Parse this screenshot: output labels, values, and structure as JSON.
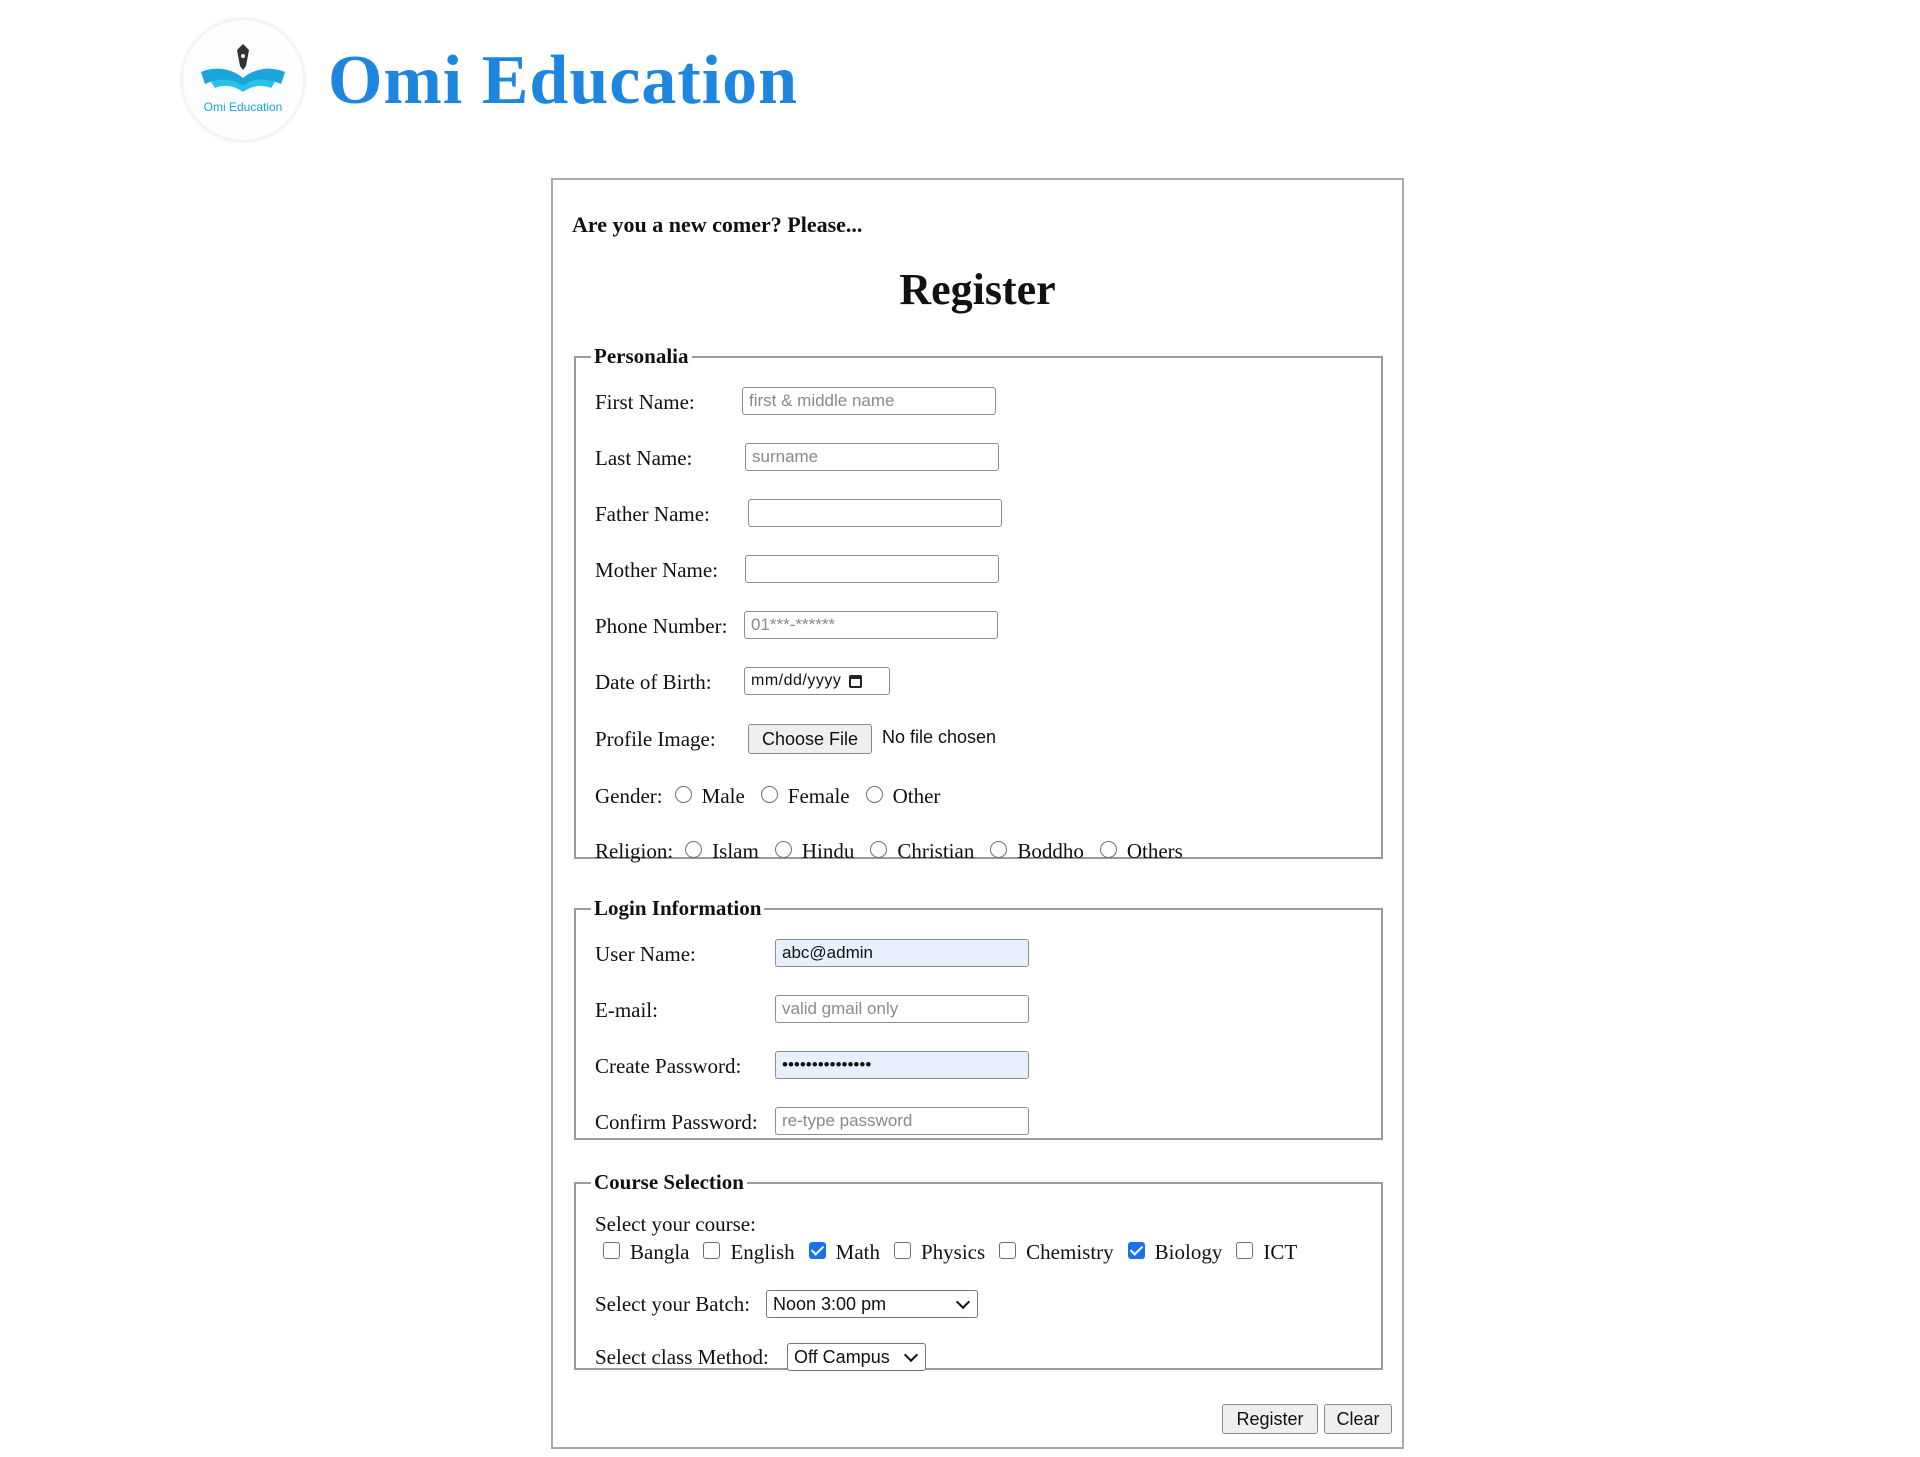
{
  "header": {
    "brand": "Omi Education",
    "logo_text": "Omi Education"
  },
  "form": {
    "intro": "Are you a new comer? Please...",
    "title": "Register",
    "personalia": {
      "legend": "Personalia",
      "first_name": {
        "label": "First Name:",
        "placeholder": "first & middle name",
        "value": ""
      },
      "last_name": {
        "label": "Last Name:",
        "placeholder": "surname",
        "value": ""
      },
      "father_name": {
        "label": "Father Name:",
        "value": ""
      },
      "mother_name": {
        "label": "Mother Name:",
        "value": ""
      },
      "phone": {
        "label": "Phone Number:",
        "placeholder": "01***-******",
        "value": ""
      },
      "dob": {
        "label": "Date of Birth:",
        "placeholder": "mm/dd/yyyy"
      },
      "profile_image": {
        "label": "Profile Image:",
        "button": "Choose File",
        "status": "No file chosen"
      },
      "gender": {
        "label": "Gender:",
        "options": [
          "Male",
          "Female",
          "Other"
        ]
      },
      "religion": {
        "label": "Religion:",
        "options": [
          "Islam",
          "Hindu",
          "Christian",
          "Boddho",
          "Others"
        ]
      }
    },
    "login": {
      "legend": "Login Information",
      "username": {
        "label": "User Name:",
        "value": "abc@admin"
      },
      "email": {
        "label": "E-mail:",
        "placeholder": "valid gmail only",
        "value": ""
      },
      "password": {
        "label": "Create Password:",
        "value": "•••••••••••••••"
      },
      "confirm": {
        "label": "Confirm Password:",
        "placeholder": "re-type password",
        "value": ""
      }
    },
    "course": {
      "legend": "Course Selection",
      "prompt": "Select your course:",
      "courses": [
        {
          "label": "Bangla",
          "checked": false
        },
        {
          "label": "English",
          "checked": false
        },
        {
          "label": "Math",
          "checked": true
        },
        {
          "label": "Physics",
          "checked": false
        },
        {
          "label": "Chemistry",
          "checked": false
        },
        {
          "label": "Biology",
          "checked": true
        },
        {
          "label": "ICT",
          "checked": false
        }
      ],
      "batch": {
        "label": "Select your Batch:",
        "selected": "Noon 3:00 pm"
      },
      "method": {
        "label": "Select class Method:",
        "selected": "Off Campus"
      }
    },
    "actions": {
      "register": "Register",
      "clear": "Clear"
    }
  },
  "colors": {
    "brand": "#1f86e0",
    "checkbox_on": "#1a73e8",
    "autofill_bg": "#e8f0fe"
  }
}
